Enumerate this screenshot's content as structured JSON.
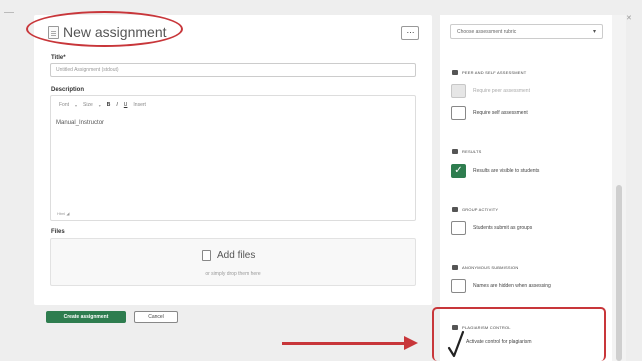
{
  "page": {
    "title": "New assignment",
    "more_label": "⋯"
  },
  "form": {
    "title_label": "Title*",
    "title_placeholder": "Untitled Assignment (stdout)",
    "description_label": "Description",
    "toolbar": {
      "font": "Font",
      "size": "Size",
      "bold": "B",
      "italic": "I",
      "underline": "U",
      "insert": "Insert"
    },
    "description_text": "Manual_Instructor",
    "status_text": "Html  ◢",
    "files_label": "Files",
    "add_files_label": "Add files",
    "drop_hint": "or simply drop them here"
  },
  "actions": {
    "create_label": "Create assignment",
    "cancel_label": "Cancel"
  },
  "sidebar": {
    "rubric_placeholder": "Choose assessment rubric",
    "rubric_caret": "▾",
    "sections": [
      {
        "heading": "Peer and self assessment",
        "options": [
          {
            "label": "Require peer assessment",
            "checked": false,
            "disabled": true
          },
          {
            "label": "Require self assessment",
            "checked": false,
            "disabled": false
          }
        ]
      },
      {
        "heading": "Results",
        "options": [
          {
            "label": "Results are visible to students",
            "checked": true,
            "disabled": false
          }
        ]
      },
      {
        "heading": "Group activity",
        "options": [
          {
            "label": "Students submit as groups",
            "checked": false,
            "disabled": false
          }
        ]
      },
      {
        "heading": "Anonymous submission",
        "options": [
          {
            "label": "Names are hidden when assessing",
            "checked": false,
            "disabled": false
          }
        ]
      },
      {
        "heading": "Plagiarism control",
        "options": [
          {
            "label": "Activate control for plagiarism",
            "checked": true,
            "disabled": false
          }
        ]
      }
    ]
  },
  "colors": {
    "accent": "#2e7d4f",
    "annotation": "#c8363a"
  }
}
